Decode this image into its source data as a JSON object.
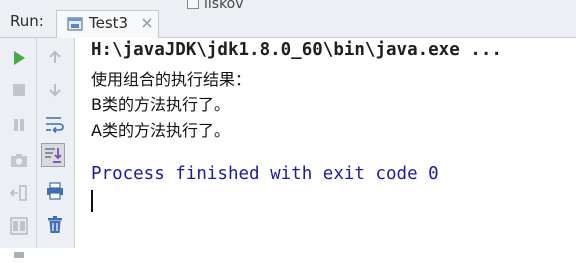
{
  "header": {
    "run_label": "Run:",
    "tab_title": "Test3",
    "behind_tab_text": "liskov"
  },
  "toolbar": {
    "left_column": [
      "run-icon",
      "stop-icon",
      "pause-icon",
      "camera-icon",
      "login-icon",
      "layout-icon",
      "pin-icon"
    ],
    "right_column": [
      "arrow-up-icon",
      "arrow-down-icon",
      "soft-wrap-icon",
      "scroll-to-end-icon",
      "print-icon",
      "trash-icon"
    ]
  },
  "console": {
    "command": "H:\\javaJDK\\jdk1.8.0_60\\bin\\java.exe ...",
    "output": [
      "使用组合的执行结果：",
      "B类的方法执行了。",
      "A类的方法执行了。"
    ],
    "finished": "Process finished with exit code 0"
  },
  "colors": {
    "toolbar_bg": "#eceff3",
    "run_green": "#4aa84a",
    "finish_blue": "#1c1aa0"
  }
}
